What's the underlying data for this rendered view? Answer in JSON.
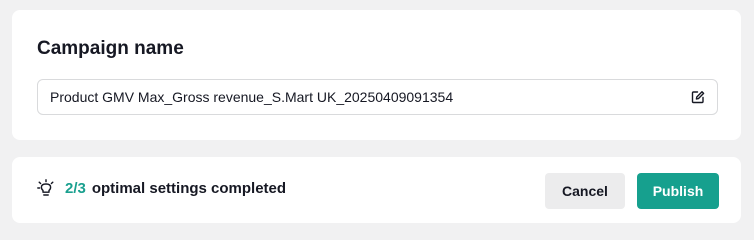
{
  "campaign": {
    "title": "Campaign name",
    "name_value": "Product GMV Max_Gross revenue_S.Mart UK_20250409091354",
    "edit_icon": "edit-icon"
  },
  "footer": {
    "tip_icon": "lightbulb-icon",
    "progress_count": "2/3",
    "progress_label": "optimal settings completed",
    "progress_fraction": 0.6667,
    "cancel_label": "Cancel",
    "publish_label": "Publish"
  },
  "colors": {
    "accent": "#16a08e",
    "page_background": "#f1f1f2",
    "card_background": "#ffffff"
  }
}
